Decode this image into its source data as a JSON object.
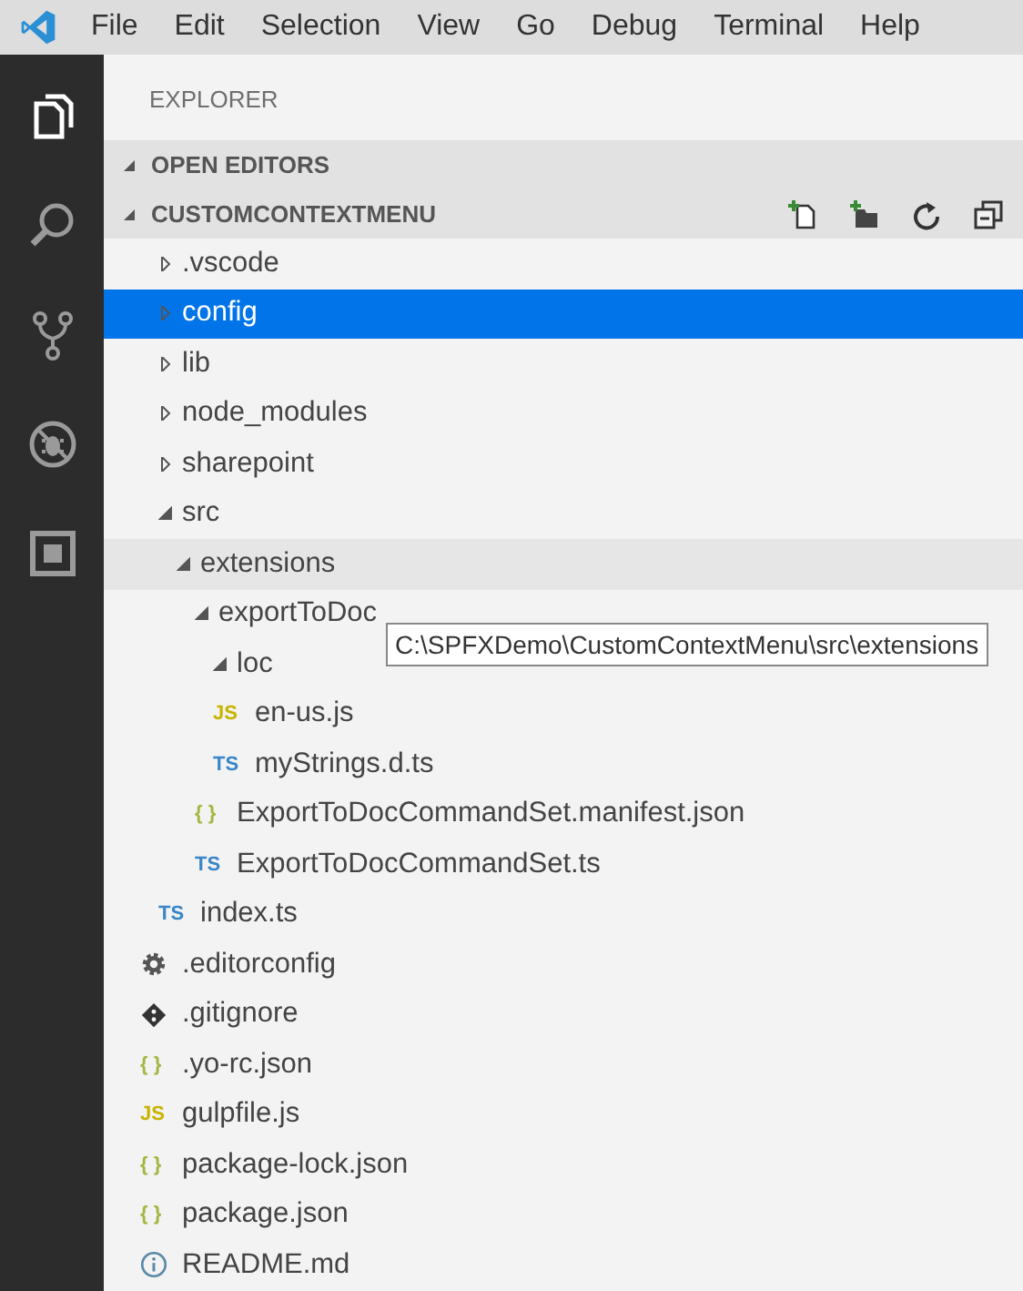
{
  "menu_bar": {
    "items": [
      "File",
      "Edit",
      "Selection",
      "View",
      "Go",
      "Debug",
      "Terminal",
      "Help"
    ]
  },
  "activity_bar": {
    "items": [
      {
        "kind": "files",
        "selected": true
      },
      {
        "kind": "search",
        "selected": false
      },
      {
        "kind": "source-control",
        "selected": false
      },
      {
        "kind": "debug",
        "selected": false
      },
      {
        "kind": "extensions",
        "selected": false
      }
    ]
  },
  "sidebar": {
    "title": "EXPLORER",
    "sections": [
      {
        "title": "OPEN EDITORS",
        "expanded": true,
        "toolbar": false
      },
      {
        "title": "CUSTOMCONTEXTMENU",
        "expanded": true,
        "toolbar": true
      }
    ],
    "tree": [
      {
        "label": ".vscode",
        "kind": "folder",
        "expanded": false,
        "selected": false,
        "hovered": false
      },
      {
        "label": "config",
        "kind": "folder",
        "expanded": false,
        "selected": true,
        "hovered": false
      },
      {
        "label": "lib",
        "kind": "folder",
        "expanded": false,
        "selected": false,
        "hovered": false
      },
      {
        "label": "node_modules",
        "kind": "folder",
        "expanded": false,
        "selected": false,
        "hovered": false
      },
      {
        "label": "sharepoint",
        "kind": "folder",
        "expanded": false,
        "selected": false,
        "hovered": false
      },
      {
        "label": "src",
        "kind": "folder",
        "expanded": true,
        "selected": false,
        "hovered": false,
        "children": [
          {
            "label": "extensions",
            "kind": "folder",
            "expanded": true,
            "selected": false,
            "hovered": true,
            "children": [
              {
                "label": "exportToDoc",
                "kind": "folder",
                "expanded": true,
                "selected": false,
                "hovered": false,
                "children": [
                  {
                    "label": "loc",
                    "kind": "folder",
                    "expanded": true,
                    "selected": false,
                    "hovered": false,
                    "children": [
                      {
                        "label": "en-us.js",
                        "kind": "badge",
                        "badge": "JS",
                        "color": "#c8b400",
                        "selected": false,
                        "hovered": false
                      },
                      {
                        "label": "myStrings.d.ts",
                        "kind": "badge",
                        "badge": "TS",
                        "color": "#3a86c8",
                        "selected": false,
                        "hovered": false
                      }
                    ]
                  },
                  {
                    "label": "ExportToDocCommandSet.manifest.json",
                    "kind": "badge",
                    "badge": "{ }",
                    "color": "#a5b540",
                    "selected": false,
                    "hovered": false
                  },
                  {
                    "label": "ExportToDocCommandSet.ts",
                    "kind": "badge",
                    "badge": "TS",
                    "color": "#3a86c8",
                    "selected": false,
                    "hovered": false
                  }
                ]
              }
            ]
          },
          {
            "label": "index.ts",
            "kind": "badge",
            "badge": "TS",
            "color": "#3a86c8",
            "selected": false,
            "hovered": false
          }
        ]
      },
      {
        "label": ".editorconfig",
        "kind": "settings",
        "selected": false,
        "hovered": false
      },
      {
        "label": ".gitignore",
        "kind": "git",
        "selected": false,
        "hovered": false
      },
      {
        "label": ".yo-rc.json",
        "kind": "badge",
        "badge": "{ }",
        "color": "#a5b540",
        "selected": false,
        "hovered": false
      },
      {
        "label": "gulpfile.js",
        "kind": "badge",
        "badge": "JS",
        "color": "#c8b400",
        "selected": false,
        "hovered": false
      },
      {
        "label": "package-lock.json",
        "kind": "badge",
        "badge": "{ }",
        "color": "#a5b540",
        "selected": false,
        "hovered": false
      },
      {
        "label": "package.json",
        "kind": "badge",
        "badge": "{ }",
        "color": "#a5b540",
        "selected": false,
        "hovered": false
      },
      {
        "label": "README.md",
        "kind": "info",
        "selected": false,
        "hovered": false
      }
    ],
    "tooltip": "C:\\SPFXDemo\\CustomContextMenu\\src\\extensions"
  }
}
